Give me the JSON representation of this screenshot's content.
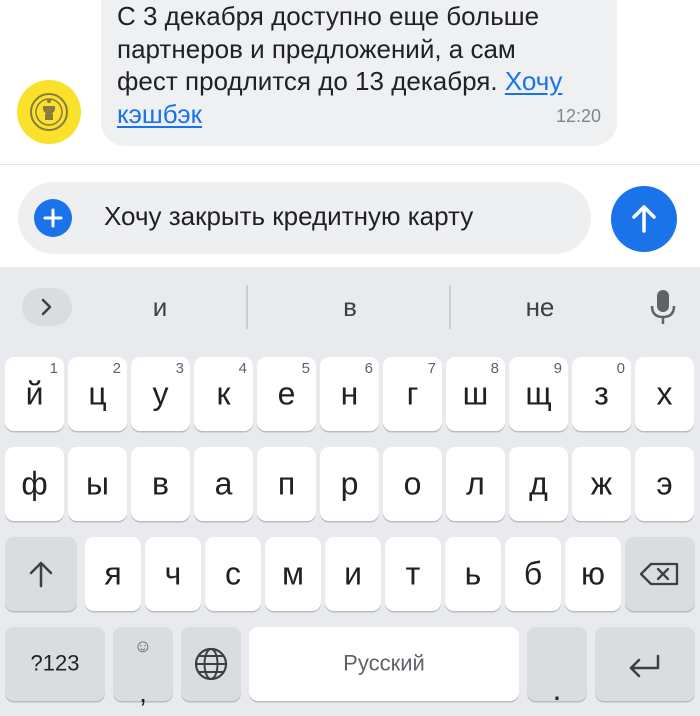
{
  "chat": {
    "message_line1": "С 3 декабря доступно еще больше",
    "message_line2": "партнеров и предложений, а сам",
    "message_line3": "фест продлится до 13 декабря.",
    "link_part1": "Хочу",
    "link_part2": "кэшбэк",
    "time": "12:20",
    "avatar_icon": "bank-logo-icon",
    "avatar_color": "#fae12b"
  },
  "compose": {
    "text": "Хочу закрыть кредитную карту",
    "add_icon": "plus-icon",
    "send_icon": "arrow-up-icon",
    "accent": "#1a73e8"
  },
  "keyboard": {
    "suggestions": [
      "и",
      "в",
      "не"
    ],
    "row1": [
      {
        "ch": "й",
        "hint": "1"
      },
      {
        "ch": "ц",
        "hint": "2"
      },
      {
        "ch": "у",
        "hint": "3"
      },
      {
        "ch": "к",
        "hint": "4"
      },
      {
        "ch": "е",
        "hint": "5"
      },
      {
        "ch": "н",
        "hint": "6"
      },
      {
        "ch": "г",
        "hint": "7"
      },
      {
        "ch": "ш",
        "hint": "8"
      },
      {
        "ch": "щ",
        "hint": "9"
      },
      {
        "ch": "з",
        "hint": "0"
      },
      {
        "ch": "х",
        "hint": ""
      }
    ],
    "row2": [
      "ф",
      "ы",
      "в",
      "а",
      "п",
      "р",
      "о",
      "л",
      "д",
      "ж",
      "э"
    ],
    "row3": [
      "я",
      "ч",
      "с",
      "м",
      "и",
      "т",
      "ь",
      "б",
      "ю"
    ],
    "symbols_label": "?123",
    "comma": ",",
    "emoji_hint": "☺",
    "space_label": "Русский",
    "period": "."
  }
}
